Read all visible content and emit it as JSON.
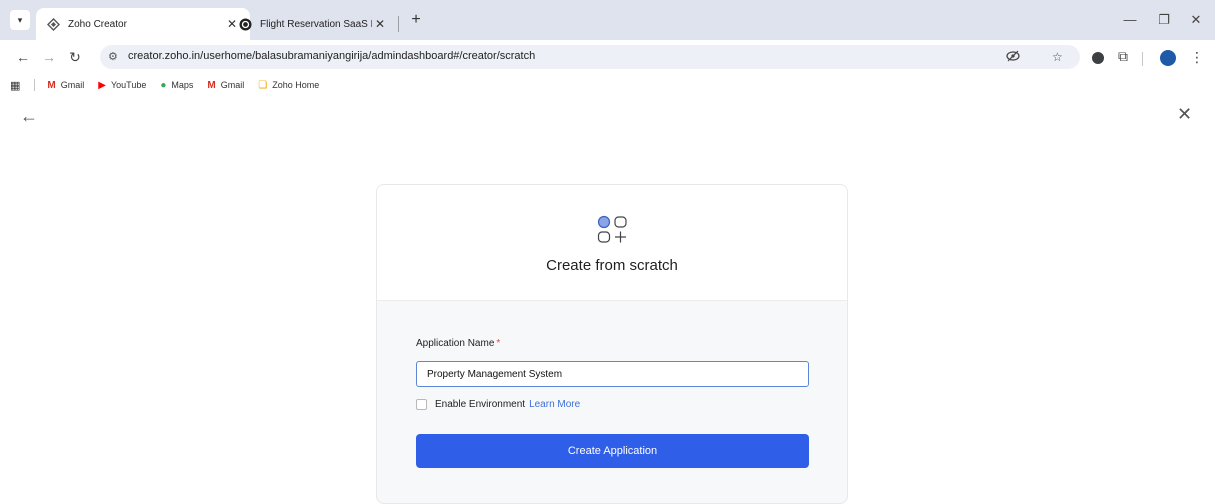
{
  "browser": {
    "tabs": [
      {
        "title": "Zoho Creator",
        "icon": "zoho-creator-favicon",
        "active": true
      },
      {
        "title": "Flight Reservation SaaS Forms",
        "icon": "zoho-forms-favicon",
        "active": false
      }
    ],
    "url": "creator.zoho.in/userhome/balasubramaniyangirija/admindashboard#/creator/scratch",
    "bookmarks": [
      {
        "label": "Gmail",
        "icon": "gmail-icon"
      },
      {
        "label": "YouTube",
        "icon": "youtube-icon"
      },
      {
        "label": "Maps",
        "icon": "maps-icon"
      },
      {
        "label": "Gmail",
        "icon": "gmail-icon"
      },
      {
        "label": "Zoho Home",
        "icon": "zoho-icon"
      }
    ]
  },
  "page": {
    "title": "Create from scratch",
    "form": {
      "app_name_label": "Application Name",
      "required_mark": "*",
      "app_name_value": "Property Management System",
      "env_label": "Enable Environment",
      "learn_more": "Learn More",
      "submit_label": "Create Application"
    }
  },
  "colors": {
    "primary": "#2f5fe8",
    "link": "#3e6fd6",
    "required": "#e74c3c",
    "tabstrip": "#dfe3ee"
  }
}
